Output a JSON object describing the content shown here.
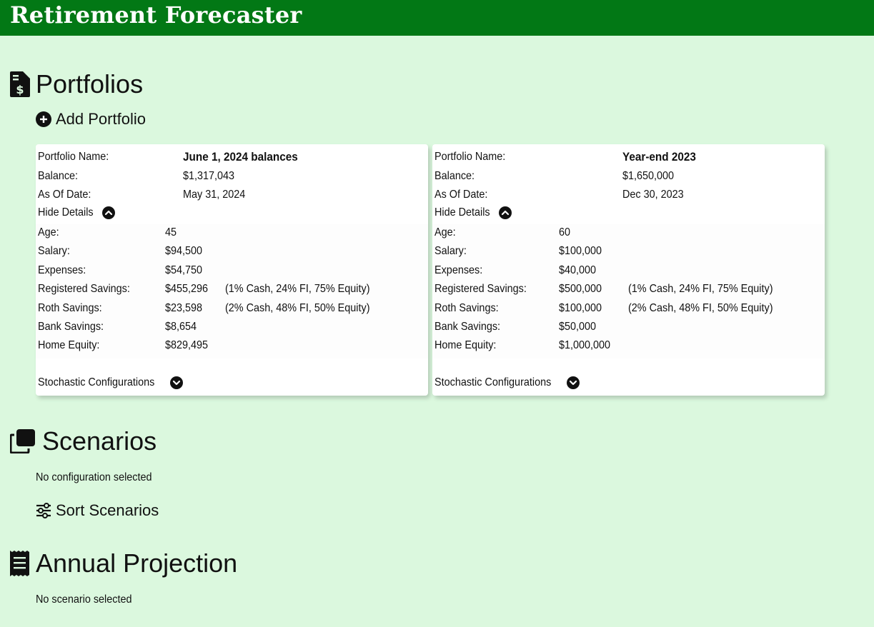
{
  "app": {
    "title": "Retirement Forecaster"
  },
  "colors": {
    "header_bg": "#027815",
    "page_bg": "#dbf8de",
    "card_bg": "#ffffff"
  },
  "portfolios": {
    "heading": "Portfolios",
    "icon": "file-dollar-icon",
    "add_label": "Add Portfolio",
    "add_icon": "plus-circle-icon",
    "cards": [
      {
        "labels": {
          "name": "Portfolio Name:",
          "balance": "Balance:",
          "as_of": "As Of Date:"
        },
        "name": "June 1, 2024 balances",
        "balance": "$1,317,043",
        "as_of": "May 31, 2024",
        "hide_details": "Hide Details",
        "details": [
          {
            "label": "Age:",
            "value": "45",
            "extra": ""
          },
          {
            "label": "Salary:",
            "value": "$94,500",
            "extra": ""
          },
          {
            "label": "Expenses:",
            "value": "$54,750",
            "extra": ""
          },
          {
            "label": "Registered Savings:",
            "value": "$455,296",
            "extra": "(1% Cash, 24% FI, 75% Equity)"
          },
          {
            "label": "Roth Savings:",
            "value": "$23,598",
            "extra": "(2% Cash, 48% FI, 50% Equity)"
          },
          {
            "label": "Bank Savings:",
            "value": "$8,654",
            "extra": ""
          },
          {
            "label": "Home Equity:",
            "value": "$829,495",
            "extra": ""
          }
        ],
        "stochastic": "Stochastic Configurations"
      },
      {
        "labels": {
          "name": "Portfolio Name:",
          "balance": "Balance:",
          "as_of": "As Of Date:"
        },
        "name": "Year-end 2023",
        "balance": "$1,650,000",
        "as_of": "Dec 30, 2023",
        "hide_details": "Hide Details",
        "details": [
          {
            "label": "Age:",
            "value": "60",
            "extra": ""
          },
          {
            "label": "Salary:",
            "value": "$100,000",
            "extra": ""
          },
          {
            "label": "Expenses:",
            "value": "$40,000",
            "extra": ""
          },
          {
            "label": "Registered Savings:",
            "value": "$500,000",
            "extra": "(1% Cash, 24% FI, 75% Equity)"
          },
          {
            "label": "Roth Savings:",
            "value": "$100,000",
            "extra": "(2% Cash, 48% FI, 50% Equity)"
          },
          {
            "label": "Bank Savings:",
            "value": "$50,000",
            "extra": ""
          },
          {
            "label": "Home Equity:",
            "value": "$1,000,000",
            "extra": ""
          }
        ],
        "stochastic": "Stochastic Configurations"
      }
    ]
  },
  "scenarios": {
    "heading": "Scenarios",
    "icon": "copy-icon",
    "empty": "No configuration selected",
    "sort_label": "Sort Scenarios",
    "sort_icon": "sliders-icon"
  },
  "projection": {
    "heading": "Annual Projection",
    "icon": "receipt-icon",
    "empty": "No scenario selected"
  }
}
